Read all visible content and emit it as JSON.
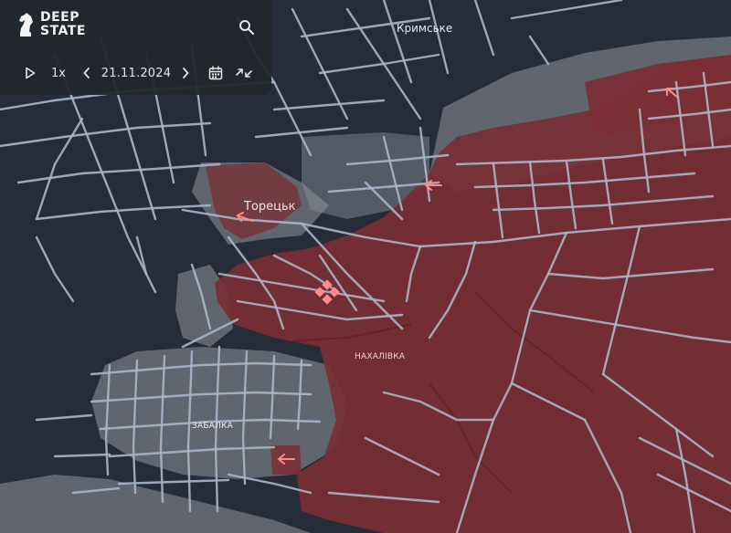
{
  "app": {
    "logo_line1": "DEEP",
    "logo_line2": "STATE"
  },
  "controls": {
    "speed": "1x",
    "date": "21.11.2024"
  },
  "map_labels": {
    "krymske": "Кримське",
    "toretsk": "Торецьк",
    "nakhalivka": "НАХАЛІВКА",
    "zabalka": "ЗАБАЛКА"
  },
  "colors": {
    "background": "#262d38",
    "roads": "#a9b6c9",
    "contested_gray": "#8f949b",
    "occupied_red": "#7a2f35",
    "arrow": "#ff8a8a"
  },
  "icons": [
    "deepstate-knight-logo",
    "search-icon",
    "play-icon",
    "chevron-left-icon",
    "chevron-right-icon",
    "calendar-icon",
    "compress-arrows-icon",
    "attack-arrow-icon",
    "frontline-marker-icon"
  ]
}
